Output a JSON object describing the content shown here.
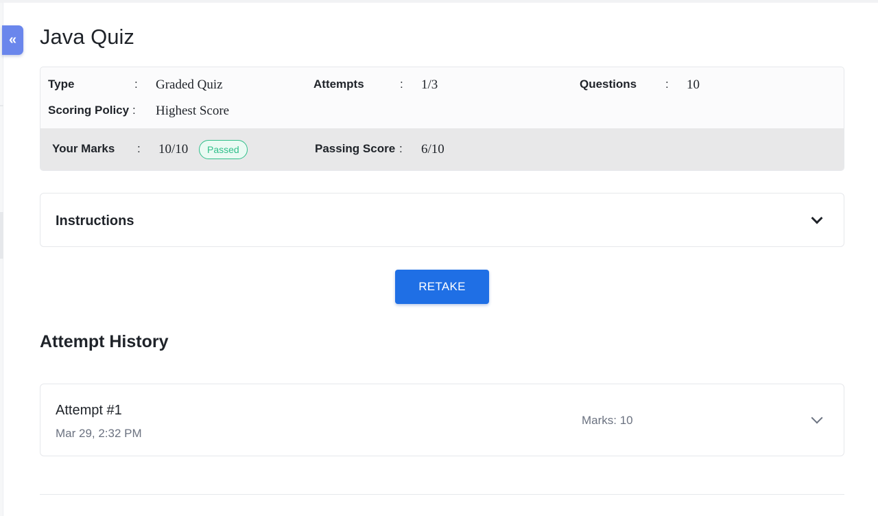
{
  "sidebar": {
    "collapse_glyph": "«",
    "collapse_icon": "double-chevron-left-icon"
  },
  "quiz": {
    "title": "Java Quiz"
  },
  "info": {
    "type_label": "Type",
    "type_value": "Graded Quiz",
    "attempts_label": "Attempts",
    "attempts_value": "1/3",
    "questions_label": "Questions",
    "questions_value": "10",
    "scoring_label": "Scoring Policy",
    "scoring_value": "Highest Score",
    "colon": ":"
  },
  "marks": {
    "your_marks_label": "Your Marks",
    "your_marks_value": "10/10",
    "status_badge": "Passed",
    "passing_label": "Passing Score",
    "passing_value": "6/10"
  },
  "instructions": {
    "label": "Instructions",
    "toggle_icon": "chevron-down-icon"
  },
  "actions": {
    "retake_label": "RETAKE"
  },
  "history": {
    "title": "Attempt History",
    "attempts": [
      {
        "name": "Attempt #1",
        "date": "Mar 29, 2:32 PM",
        "marks": "Marks: 10"
      }
    ]
  },
  "colors": {
    "accent": "#1f6fe5",
    "collapse_button": "#6a86ec",
    "passed": "#2fbf8a",
    "marks_band": "#e8e8e9",
    "muted_text": "#6b7280"
  }
}
